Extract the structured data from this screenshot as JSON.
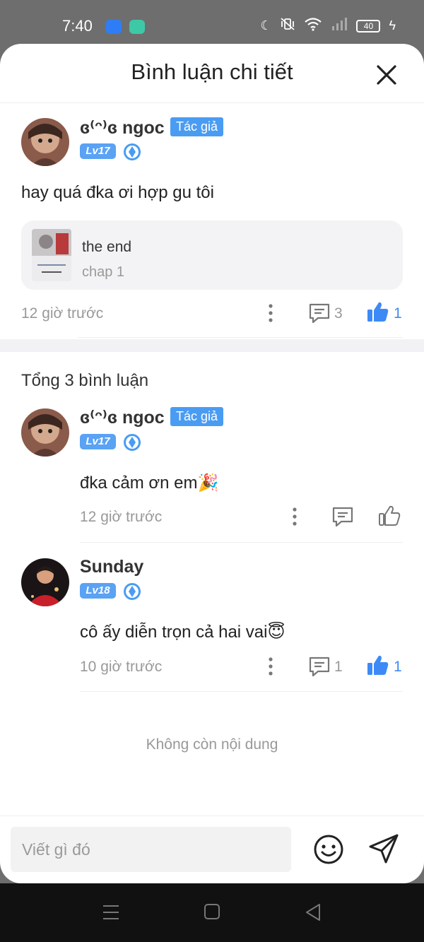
{
  "status_bar": {
    "time": "7:40",
    "battery": "40"
  },
  "header": {
    "title": "Bình luận chi tiết"
  },
  "main_comment": {
    "username": "ɞ⁽ᵔ⁾ɞ ngoc",
    "author_badge": "Tác giả",
    "level": "Lv17",
    "text": "hay quá đka ơi hợp gu tôi",
    "chapter": {
      "title": "the end",
      "subtitle": "chap 1"
    },
    "time": "12 giờ trước",
    "reply_count": "3",
    "like_count": "1"
  },
  "replies_section": {
    "total_label": "Tổng 3 bình luận",
    "replies": [
      {
        "username": "ɞ⁽ᵔ⁾ɞ ngoc",
        "author_badge": "Tác giả",
        "level": "Lv17",
        "text": "đka cảm ơn em🎉",
        "time": "12 giờ trước"
      },
      {
        "username": "Sunday",
        "level": "Lv18",
        "text": "cô ấy diễn trọn cả hai vai😇",
        "time": "10 giờ trước",
        "reply_count": "1",
        "like_count": "1"
      }
    ],
    "end_label": "Không còn nội dung"
  },
  "input_bar": {
    "placeholder": "Viết gì đó"
  },
  "colors": {
    "accent": "#3d8af7",
    "badge": "#4a9cf3",
    "level": "#5aa2f4"
  }
}
